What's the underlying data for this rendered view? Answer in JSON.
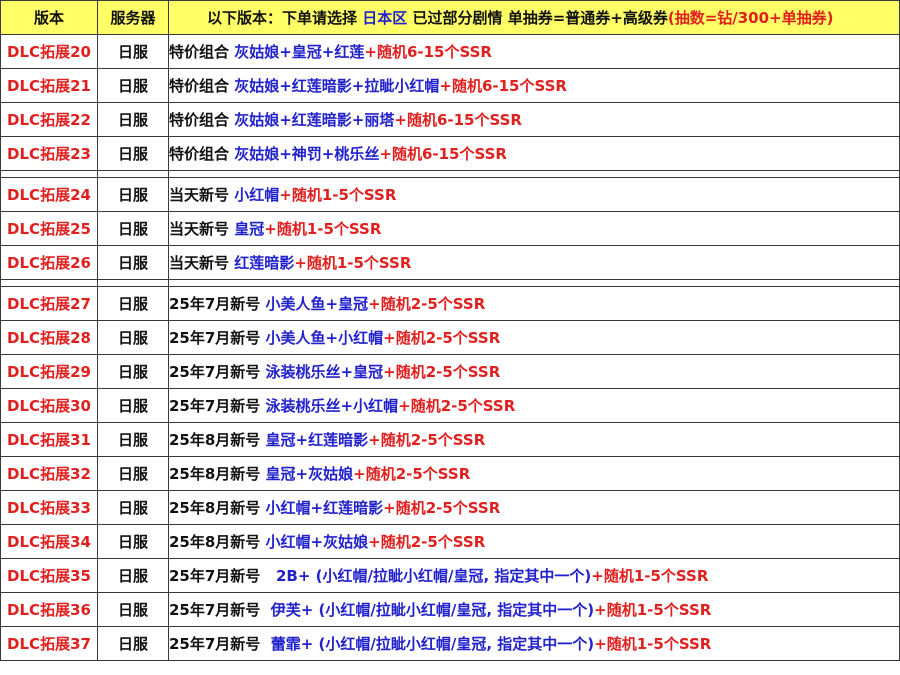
{
  "colors": {
    "header_bg": "#ffff66",
    "version_red": "#e0201f",
    "character_blue": "#2222cc",
    "border": "#3a3a3a"
  },
  "header": {
    "col1": "版本",
    "col2": "服务器",
    "col3": {
      "part1": "以下版本：下单请选择 ",
      "part2": "日本区",
      "part3": " 已过部分剧情 单抽券=普通券+高级券",
      "part4": "(抽数=钻/300+单抽券)"
    }
  },
  "rows": [
    {
      "version": "DLC拓展20",
      "server": "日服",
      "p1": "特价组合 ",
      "p2": "灰姑娘+皇冠+红莲",
      "p3": "+随机6-15个SSR"
    },
    {
      "version": "DLC拓展21",
      "server": "日服",
      "p1": "特价组合 ",
      "p2": "灰姑娘+红莲暗影+拉眦小红帽",
      "p3": "+随机6-15个SSR"
    },
    {
      "version": "DLC拓展22",
      "server": "日服",
      "p1": "特价组合 ",
      "p2": "灰姑娘+红莲暗影+丽塔",
      "p3": "+随机6-15个SSR"
    },
    {
      "version": "DLC拓展23",
      "server": "日服",
      "p1": "特价组合 ",
      "p2": "灰姑娘+神罚+桃乐丝",
      "p3": "+随机6-15个SSR"
    },
    {
      "version": "DLC拓展24",
      "server": "日服",
      "p1": "当天新号 ",
      "p2": "小红帽",
      "p3": "+随机1-5个SSR"
    },
    {
      "version": "DLC拓展25",
      "server": "日服",
      "p1": "当天新号 ",
      "p2": "皇冠",
      "p3": "+随机1-5个SSR"
    },
    {
      "version": "DLC拓展26",
      "server": "日服",
      "p1": "当天新号 ",
      "p2": "红莲暗影",
      "p3": "+随机1-5个SSR"
    },
    {
      "version": "DLC拓展27",
      "server": "日服",
      "p1": "25年7月新号 ",
      "p2": "小美人鱼+皇冠",
      "p3": "+随机2-5个SSR"
    },
    {
      "version": "DLC拓展28",
      "server": "日服",
      "p1": "25年7月新号 ",
      "p2": "小美人鱼+小红帽",
      "p3": "+随机2-5个SSR"
    },
    {
      "version": "DLC拓展29",
      "server": "日服",
      "p1": "25年7月新号 ",
      "p2": "泳装桃乐丝+皇冠",
      "p3": "+随机2-5个SSR"
    },
    {
      "version": "DLC拓展30",
      "server": "日服",
      "p1": "25年7月新号 ",
      "p2": "泳装桃乐丝+小红帽",
      "p3": "+随机2-5个SSR"
    },
    {
      "version": "DLC拓展31",
      "server": "日服",
      "p1": "25年8月新号 ",
      "p2": "皇冠+红莲暗影",
      "p3": "+随机2-5个SSR"
    },
    {
      "version": "DLC拓展32",
      "server": "日服",
      "p1": "25年8月新号 ",
      "p2": "皇冠+灰姑娘",
      "p3": "+随机2-5个SSR"
    },
    {
      "version": "DLC拓展33",
      "server": "日服",
      "p1": "25年8月新号 ",
      "p2": "小红帽+红莲暗影",
      "p3": "+随机2-5个SSR"
    },
    {
      "version": "DLC拓展34",
      "server": "日服",
      "p1": "25年8月新号 ",
      "p2": "小红帽+灰姑娘",
      "p3": "+随机2-5个SSR"
    },
    {
      "version": "DLC拓展35",
      "server": "日服",
      "p1": "25年7月新号 ",
      "p2": "  2B+ (小红帽/拉眦小红帽/皇冠, 指定其中一个)",
      "p3": "+随机1-5个SSR"
    },
    {
      "version": "DLC拓展36",
      "server": "日服",
      "p1": "25年7月新号 ",
      "p2": " 伊芙+ (小红帽/拉眦小红帽/皇冠, 指定其中一个)",
      "p3": "+随机1-5个SSR"
    },
    {
      "version": "DLC拓展37",
      "server": "日服",
      "p1": "25年7月新号 ",
      "p2": " 蕾霏+ (小红帽/拉眦小红帽/皇冠, 指定其中一个)",
      "p3": "+随机1-5个SSR"
    }
  ]
}
